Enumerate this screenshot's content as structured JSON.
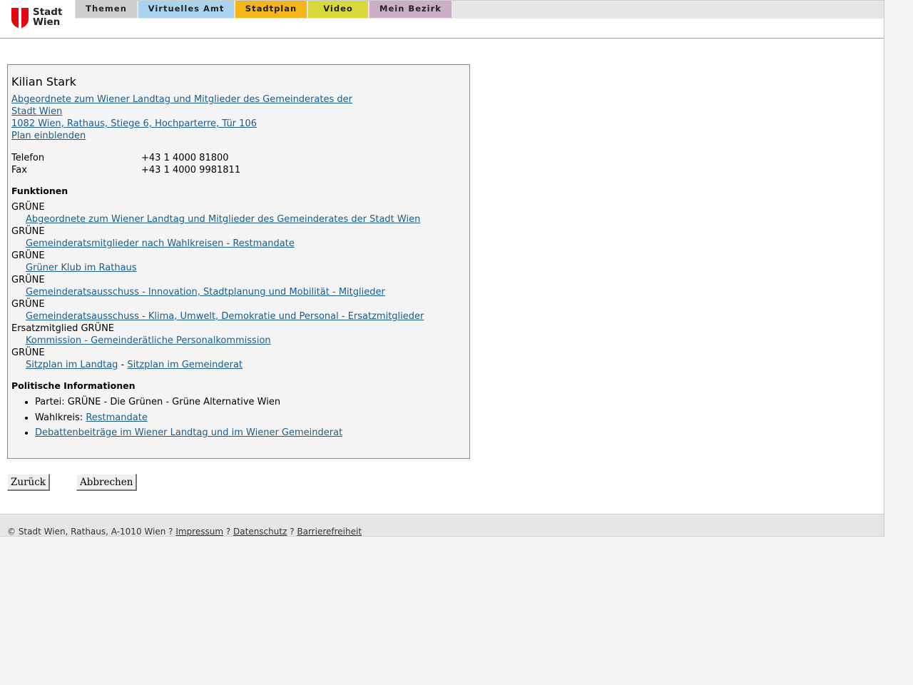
{
  "header": {
    "logo_text_line1": "Stadt",
    "logo_text_line2": "Wien",
    "brand_color": "#e30613",
    "tabs": [
      {
        "label": "Themen",
        "color": "#cfcfcf"
      },
      {
        "label": "Virtuelles Amt",
        "color": "#a9d3ef"
      },
      {
        "label": "Stadtplan",
        "color": "#f4b51a"
      },
      {
        "label": "Video",
        "color": "#d7d83b"
      },
      {
        "label": "Mein Bezirk",
        "color": "#c9aec6"
      }
    ]
  },
  "person": {
    "name": "Kilian Stark",
    "org_line1": "Abgeordnete zum Wiener Landtag und Mitglieder des Gemeinderates der",
    "org_line2": "Stadt Wien",
    "address": "1082 Wien, Rathaus, Stiege 6, Hochparterre, Tür 106",
    "map_link": "Plan einblenden",
    "contact": [
      {
        "label": "Telefon",
        "value": "+43 1 4000 81800"
      },
      {
        "label": "Fax",
        "value": "+43 1 4000 9981811"
      }
    ]
  },
  "functions": {
    "title": "Funktionen",
    "items": [
      {
        "party": "GRÜNE",
        "link": "Abgeordnete zum Wiener Landtag und Mitglieder des Gemeinderates der Stadt Wien"
      },
      {
        "party": "GRÜNE",
        "link": "Gemeinderatsmitglieder nach Wahlkreisen - Restmandate"
      },
      {
        "party": "GRÜNE",
        "link": "Grüner Klub im Rathaus"
      },
      {
        "party": "GRÜNE",
        "link": "Gemeinderatsausschuss - Innovation, Stadtplanung und Mobilität - Mitglieder"
      },
      {
        "party": "GRÜNE",
        "link": "Gemeinderatsausschuss - Klima, Umwelt, Demokratie und Personal - Ersatzmitglieder"
      },
      {
        "party": "Ersatzmitglied GRÜNE",
        "link": "Kommission - Gemeinderätliche Personalkommission"
      }
    ],
    "last_party": "GRÜNE",
    "seat_link_landtag": "Sitzplan im Landtag",
    "seat_separator": " - ",
    "seat_link_gemeinderat": "Sitzplan im Gemeinderat"
  },
  "political": {
    "title": "Politische Informationen",
    "party_label": "Partei: ",
    "party_value": "GRÜNE - Die Grünen - Grüne Alternative Wien",
    "wahlkreis_label": "Wahlkreis: ",
    "wahlkreis_link": "Restmandate",
    "debates_link": "Debattenbeiträge im Wiener Landtag und im Wiener Gemeinderat"
  },
  "buttons": {
    "back": "Zurück",
    "cancel": "Abbrechen"
  },
  "footer": {
    "copyright": "© Stadt Wien, Rathaus, A-1010 Wien ? ",
    "impressum": "Impressum",
    "sep": " ? ",
    "datenschutz": "Datenschutz",
    "barrierefreiheit": "Barrierefreiheit"
  }
}
